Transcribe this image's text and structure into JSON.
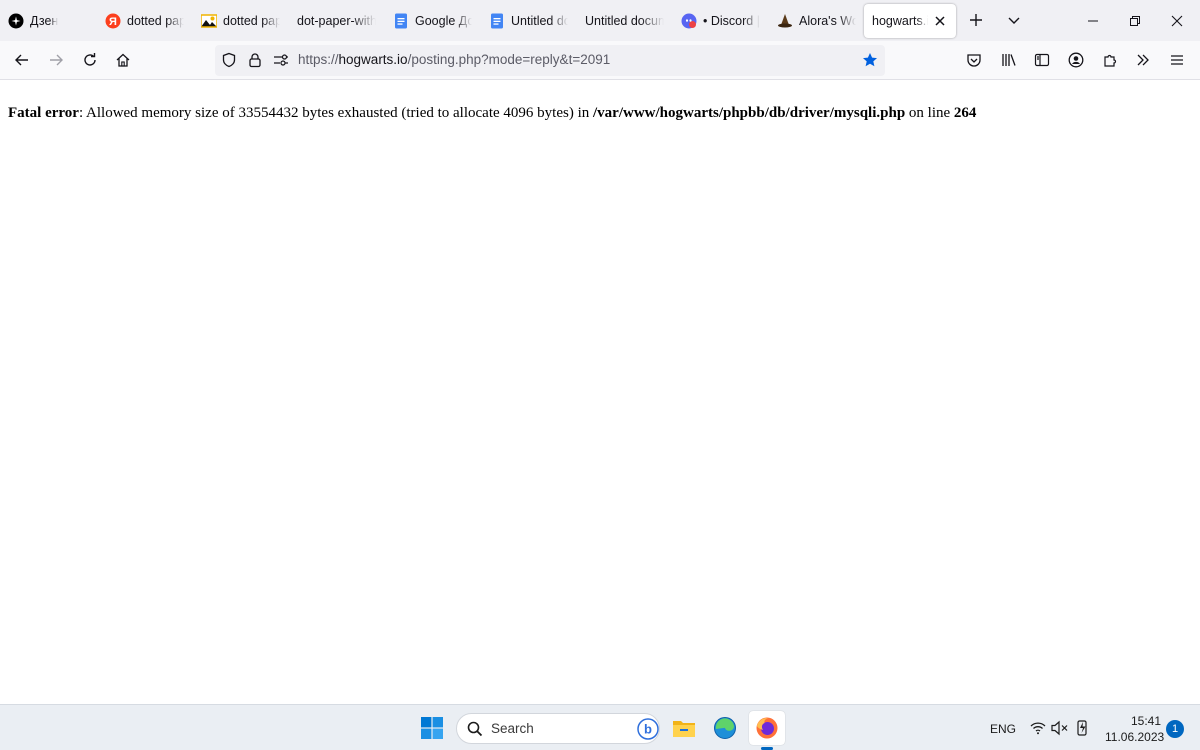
{
  "browser": {
    "tabs": [
      {
        "label": "Дзен",
        "icon": "dzen-icon"
      },
      {
        "label": "dotted pap",
        "icon": "yandex-icon"
      },
      {
        "label": "dotted pap",
        "icon": "image-icon"
      },
      {
        "label": "dot-paper-with",
        "icon": ""
      },
      {
        "label": "Google До",
        "icon": "google-docs-icon"
      },
      {
        "label": "Untitled do",
        "icon": "google-docs-icon"
      },
      {
        "label": "Untitled docum",
        "icon": ""
      },
      {
        "label": "• Discord |",
        "icon": "discord-icon"
      },
      {
        "label": "Alora's Wo",
        "icon": "wizard-hat-icon"
      },
      {
        "label": "hogwarts.io/",
        "icon": "",
        "active": true
      }
    ],
    "url": {
      "prefix": "https://",
      "host": "hogwarts.io",
      "path": "/posting.php?mode=reply&t=2091"
    }
  },
  "page": {
    "error": {
      "label": "Fatal error",
      "message_part1": ": Allowed memory size of 33554432 bytes exhausted (tried to allocate 4096 bytes) in ",
      "file": "/var/www/hogwarts/phpbb/db/driver/mysqli.php",
      "message_part2": " on line ",
      "line": "264"
    }
  },
  "taskbar": {
    "search_label": "Search",
    "language": "ENG",
    "time": "15:41",
    "date": "11.06.2023",
    "notification_count": "1"
  },
  "colors": {
    "accent_blue": "#0060df",
    "bookmark_star": "#0060df",
    "windows_blue": "#0067c0"
  }
}
